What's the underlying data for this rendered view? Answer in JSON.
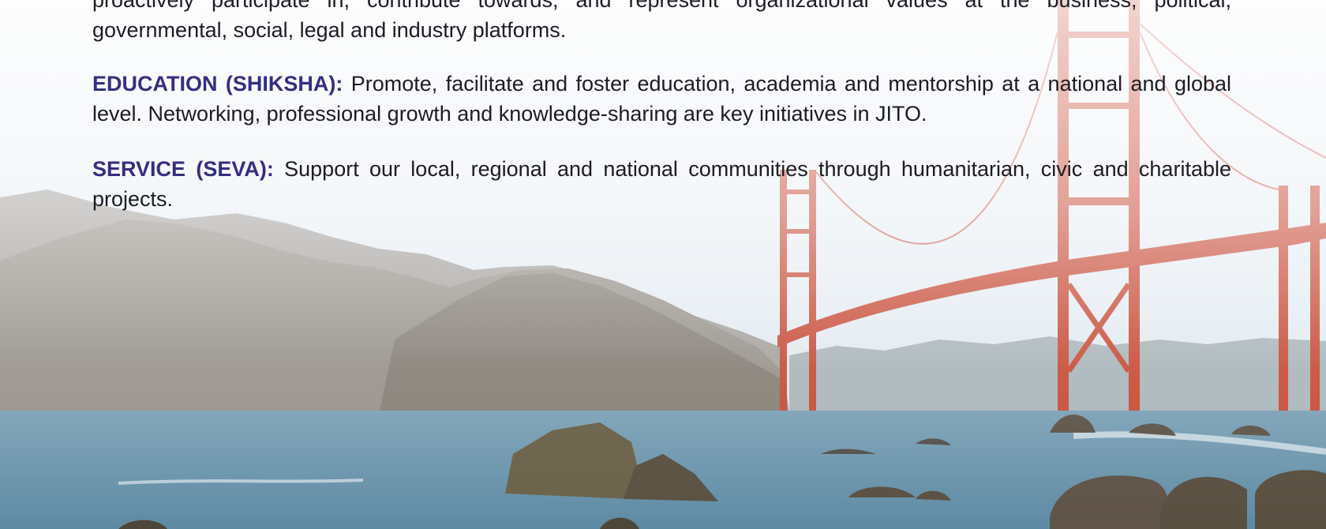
{
  "top_paragraph": {
    "line1": "proactively participate in, contribute towards, and represent organizational values at the business, political,",
    "line2": "governmental, social, legal and industry platforms."
  },
  "education": {
    "heading": "EDUCATION (SHIKSHA):",
    "body": "Promote, facilitate and foster education, academia and mentorship at a national and global level. Networking, professional growth and knowledge-sharing are key initiatives in JITO."
  },
  "service": {
    "heading": "SERVICE (SEVA):",
    "body": "Support our local, regional and national communities through humanitarian, civic and charitable projects."
  },
  "colors": {
    "heading": "#332f82",
    "body_text": "#1c1c24",
    "bridge": "#c9523f",
    "water": "#6f97ad",
    "sky": "#eef2f6"
  }
}
